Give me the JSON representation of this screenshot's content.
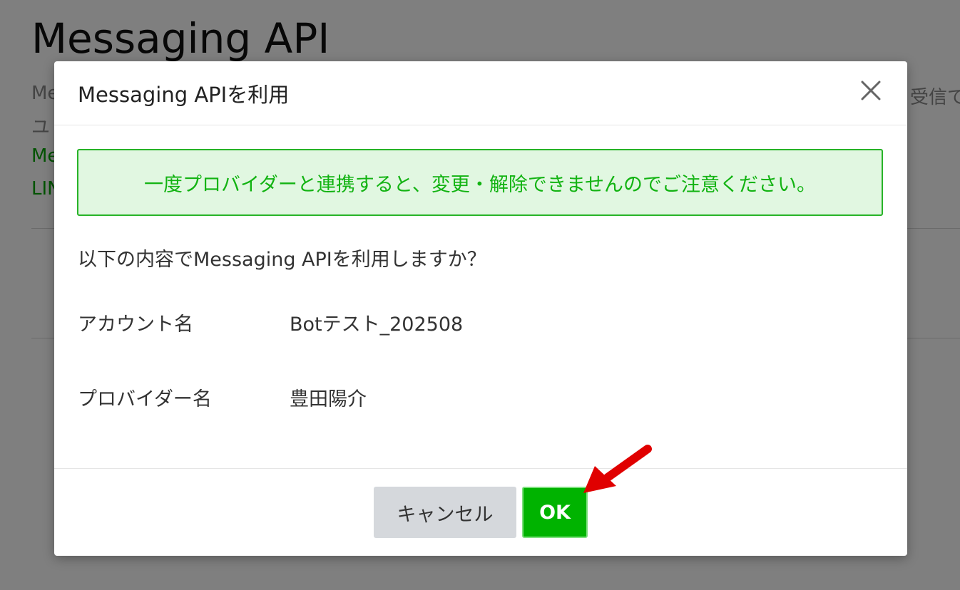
{
  "background": {
    "page_title": "Messaging API",
    "text_1": "Me",
    "text_2": "ユ",
    "text_3": "Me",
    "text_4": "LIN",
    "text_5": "受信で"
  },
  "modal": {
    "title": "Messaging APIを利用",
    "close_icon": "close-icon",
    "alert_text": "一度プロバイダーと連携すると、変更・解除できませんのでご注意ください。",
    "question": "以下の内容でMessaging APIを利用しますか？",
    "rows": [
      {
        "label": "アカウント名",
        "value": "Botテスト_202508"
      },
      {
        "label": "プロバイダー名",
        "value": "豊田陽介"
      }
    ],
    "cancel_label": "キャンセル",
    "ok_label": "OK"
  },
  "colors": {
    "overlay": "rgba(0,0,0,0.5)",
    "alert_bg": "#e1f7e1",
    "alert_border": "#27b327",
    "alert_text": "#12b312",
    "ok_button": "#00b300",
    "cancel_button": "#d5d8dc",
    "annotation_arrow": "#e00000"
  }
}
